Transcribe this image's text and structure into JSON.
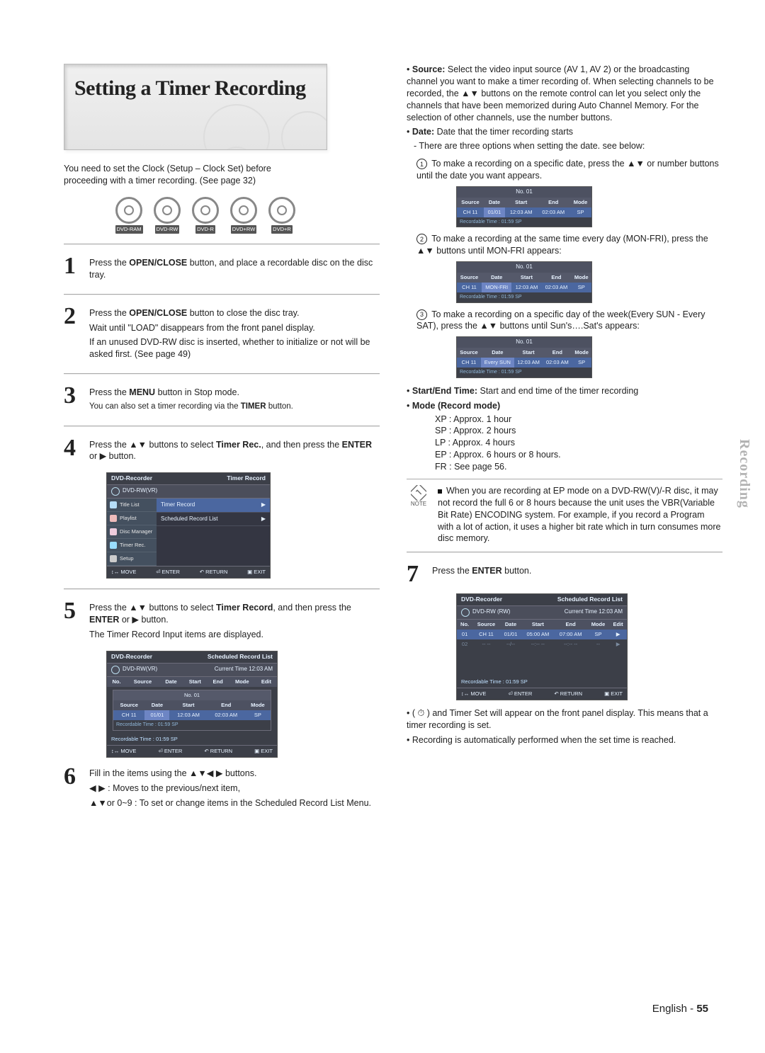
{
  "title": "Setting a Timer Recording",
  "clock_note": [
    "You need to set the Clock (Setup – Clock Set) before",
    "proceeding with a timer recording. (See page 32)"
  ],
  "disc_types": [
    "DVD-RAM",
    "DVD-RW",
    "DVD-R",
    "DVD+RW",
    "DVD+R"
  ],
  "steps_left": {
    "1": {
      "text": "Press the OPEN/CLOSE button, and place a recordable disc on the disc tray.",
      "bold": "OPEN/CLOSE"
    },
    "2": {
      "l1": "Press the OPEN/CLOSE button to close the disc tray.",
      "l1_bold": "OPEN/CLOSE",
      "l2": "Wait until \"LOAD\" disappears from the front panel display.",
      "l3": "If an unused DVD-RW disc is inserted, whether to initialize or not will be asked first. (See page 49)"
    },
    "3": {
      "l1": "Press the MENU button in Stop mode.",
      "l1_bold": "MENU",
      "l2": "You can also set a timer recording via the TIMER button.",
      "l2_bold": "TIMER"
    },
    "4": {
      "l1a": "Press the ▲▼ buttons to select ",
      "l1_bold": "Timer Rec.",
      "l1b": ", and then press the ",
      "l1_bold2": "ENTER",
      "l1c": " or ▶ button."
    },
    "5": {
      "l1a": "Press the ▲▼ buttons to select ",
      "l1_bold": "Timer Record",
      "l1b": ", and then press the ",
      "l1_bold2": "ENTER",
      "l1c": " or ▶ button.",
      "l2": "The Timer Record Input items are displayed."
    },
    "6": {
      "l1": "Fill in the items using the ▲▼◀ ▶ buttons.",
      "l2": "◀ ▶ : Moves to the previous/next item,",
      "l3": "▲▼or 0~9 : To set or change items in the Scheduled Record List Menu."
    }
  },
  "menu_ui": {
    "title_left": "DVD-Recorder",
    "title_right": "Timer Record",
    "sub_disc": "DVD-RW(VR)",
    "left_items": [
      "Title List",
      "Playlist",
      "Disc Manager",
      "Timer Rec.",
      "Setup"
    ],
    "right_items": [
      "Timer Record",
      "Scheduled Record List"
    ],
    "footer": [
      "↕↔ MOVE",
      "⏎ ENTER",
      "↶ RETURN",
      "▣ EXIT"
    ]
  },
  "sched_ui": {
    "title_left": "DVD-Recorder",
    "title_right": "Scheduled Record List",
    "sub_disc": "DVD-RW(VR)",
    "current_time_label": "Current Time  12:03 AM",
    "cols": [
      "No.",
      "Source",
      "Date",
      "Start",
      "End",
      "Mode",
      "Edit"
    ],
    "inner_title": "No. 01",
    "inner_cols": [
      "Source",
      "Date",
      "Start",
      "End",
      "Mode"
    ],
    "row": [
      "CH 11",
      "01/01",
      "12:03 AM",
      "02:03 AM",
      "SP"
    ],
    "inner_rec": "Recordable Time : 01:59 SP",
    "outer_rec": "Recordable Time : 01:59  SP",
    "footer": [
      "↕↔ MOVE",
      "⏎ ENTER",
      "↶ RETURN",
      "▣ EXIT"
    ]
  },
  "right": {
    "bullets_top": {
      "source": {
        "label": "Source:",
        "text": "Select the video input source (AV 1, AV 2) or  the broadcasting channel you want to make a  timer recording of. When selecting channels to be recorded, the ▲▼ buttons on the remote control can let you select only the channels that have been memorized during Auto Channel Memory. For the selection of other channels, use the number buttons."
      },
      "date": {
        "label": "Date:",
        "text": "Date that the timer recording starts",
        "sub": "There are three options when setting the date. see below:"
      }
    },
    "cases": {
      "1": {
        "text": "To make a recording on a specific date, press the ▲▼ or number buttons until the date you want appears.",
        "row": [
          "CH 11",
          "01/01",
          "12:03 AM",
          "02:03 AM",
          "SP"
        ]
      },
      "2": {
        "text": "To make a recording at the same time every day (MON-FRI), press the ▲▼ buttons until MON-FRI appears:",
        "row": [
          "CH 11",
          "MON-FRI",
          "12:03 AM",
          "02:03 AM",
          "SP"
        ]
      },
      "3": {
        "text": "To make a recording on a specific day of the week(Every SUN - Every SAT), press the ▲▼ buttons until Sun's….Sat's appears:",
        "row": [
          "CH 11",
          "Every SUN",
          "12:03 AM",
          "02:03 AM",
          "SP"
        ]
      }
    },
    "mini_title": "No. 01",
    "mini_cols": [
      "Source",
      "Date",
      "Start",
      "End",
      "Mode"
    ],
    "mini_rec": "Recordable Time : 01:59 SP",
    "start_end": {
      "label": "Start/End Time:",
      "text": "Start and end time of the timer recording"
    },
    "mode_label": "Mode (Record mode)",
    "mode_lines": [
      "XP : Approx. 1 hour",
      "SP : Approx. 2 hours",
      "LP : Approx. 4 hours",
      "EP : Approx. 6 hours or 8 hours.",
      "FR : See page 56."
    ],
    "note_label": "NOTE",
    "note_text": "When you are recording at EP mode on a DVD-RW(V)/-R disc, it may not record the full 6 or 8 hours because the unit uses the VBR(Variable Bit Rate) ENCODING system. For example, if you record a Program with a lot of action, it uses a higher bit rate which in turn consumes more disc memory.",
    "step7": {
      "pre": "Press the ",
      "bold": "ENTER",
      "post": " button."
    },
    "step7_ui": {
      "title_left": "DVD-Recorder",
      "title_right": "Scheduled Record List",
      "sub_disc": "DVD-RW (RW)",
      "current_time_label": "Current Time  12:03 AM",
      "cols": [
        "No.",
        "Source",
        "Date",
        "Start",
        "End",
        "Mode",
        "Edit"
      ],
      "rows": [
        [
          "01",
          "CH 11",
          "01/01",
          "05:00 AM",
          "07:00 AM",
          "SP",
          "▶"
        ],
        [
          "02",
          "-- --",
          "--/--",
          "--:-- --",
          "--:-- --",
          "--",
          "▶"
        ]
      ],
      "rec": "Recordable Time :  01:59  SP",
      "footer": [
        "↕↔ MOVE",
        "⏎ ENTER",
        "↶ RETURN",
        "▣ EXIT"
      ]
    },
    "tail_bullets": [
      "( ⏱ ) and Timer Set will appear on the front panel display. This means that a timer recording is set.",
      "Recording is automatically performed when the set time is reached."
    ]
  },
  "page_number": "55",
  "page_label": "English -",
  "side_tab": "Recording"
}
